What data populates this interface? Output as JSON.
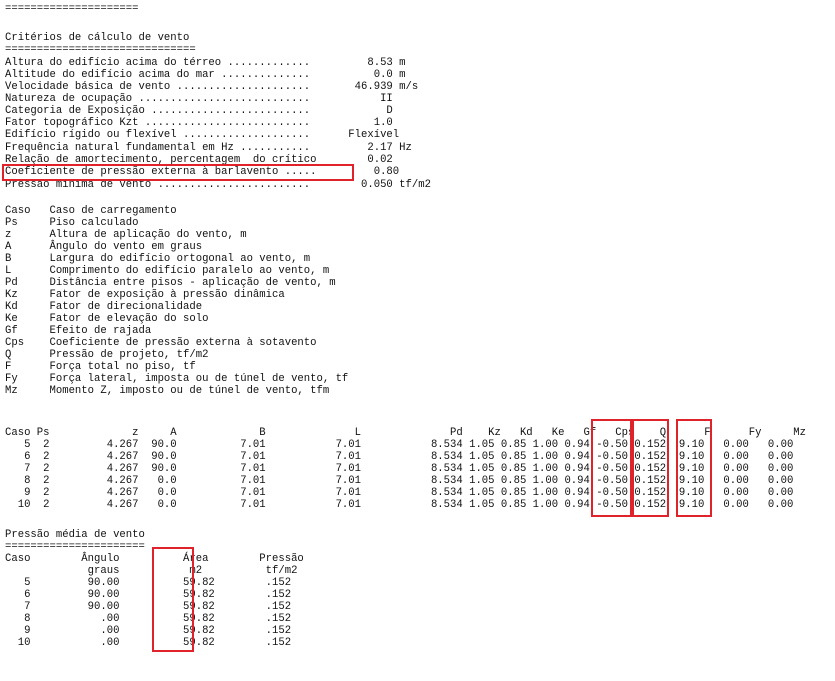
{
  "top_rule": "=====================",
  "criteria": {
    "title": "Critérios de cálculo de vento",
    "rule": "==============================",
    "lines": [
      "Altura do edifício acima do térreo .............         8.53 m",
      "Altitude do edifício acima do mar ..............          0.0 m",
      "Velocidade básica de vento .....................       46.939 m/s",
      "Natureza de ocupação ...........................           II",
      "Categoria de Exposição .........................            D",
      "Fator topográfico Kzt ..........................          1.0",
      "Edifício rígido ou flexível ....................      Flexível",
      "Frequência natural fundamental em Hz ...........         2.17 Hz",
      "Relação de amortecimento, percentagem  do crítico        0.02",
      "Coeficiente de pressão externa à barlavento .....         0.80",
      "Pressão mínima de vento ........................        0.050 tf/m2"
    ]
  },
  "legend": [
    "Caso   Caso de carregamento",
    "Ps     Piso calculado",
    "z      Altura de aplicação do vento, m",
    "A      Ângulo do vento em graus",
    "B      Largura do edifício ortogonal ao vento, m",
    "L      Comprimento do edifício paralelo ao vento, m",
    "Pd     Distância entre pisos - aplicação de vento, m",
    "Kz     Fator de exposição à pressão dinâmica",
    "Kd     Fator de direcionalidade",
    "Ke     Fator de elevação do solo",
    "Gf     Efeito de rajada",
    "Cps    Coeficiente de pressão externa à sotavento",
    "Q      Pressão de projeto, tf/m2",
    "F      Força total no piso, tf",
    "Fy     Força lateral, imposta ou de túnel de vento, tf",
    "Mz     Momento Z, imposto ou de túnel de vento, tfm"
  ],
  "cases_table": {
    "header": "Caso Ps             z     A             B              L              Pd    Kz   Kd   Ke   Gf   Cps    Q      F      Fy     Mz",
    "rows": [
      "   5  2         4.267  90.0          7.01           7.01           8.534 1.05 0.85 1.00 0.94 -0.50 0.152  9.10   0.00   0.00",
      "   6  2         4.267  90.0          7.01           7.01           8.534 1.05 0.85 1.00 0.94 -0.50 0.152  9.10   0.00   0.00",
      "   7  2         4.267  90.0          7.01           7.01           8.534 1.05 0.85 1.00 0.94 -0.50 0.152  9.10   0.00   0.00",
      "   8  2         4.267   0.0          7.01           7.01           8.534 1.05 0.85 1.00 0.94 -0.50 0.152  9.10   0.00   0.00",
      "   9  2         4.267   0.0          7.01           7.01           8.534 1.05 0.85 1.00 0.94 -0.50 0.152  9.10   0.00   0.00",
      "  10  2         4.267   0.0          7.01           7.01           8.534 1.05 0.85 1.00 0.94 -0.50 0.152  9.10   0.00   0.00"
    ]
  },
  "mean_pressure": {
    "title": "Pressão média de vento",
    "rule": "======================",
    "header1": "Caso        Ângulo          Área        Pressão",
    "header2": "             graus           m2          tf/m2",
    "rows": [
      "   5         90.00          59.82        .152",
      "   6         90.00          59.82        .152",
      "   7         90.00          59.82        .152",
      "   8           .00          59.82        .152",
      "   9           .00          59.82        .152",
      "  10           .00          59.82        .152"
    ]
  },
  "highlight_color": "#e0232b"
}
